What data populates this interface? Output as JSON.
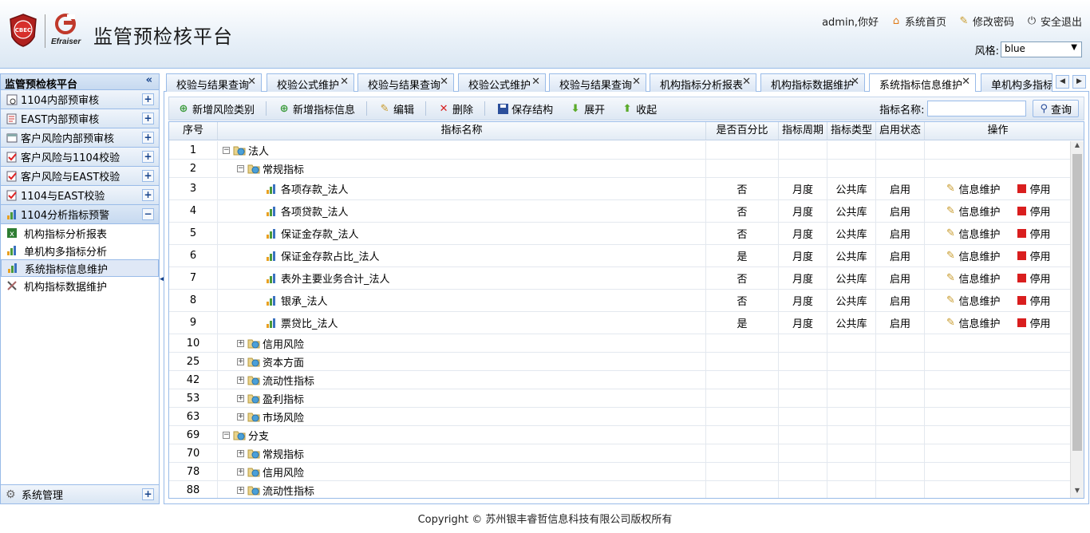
{
  "header": {
    "title": "监管预检核平台",
    "logo_text": "CBEC",
    "logo2_text": "Efraiser",
    "user_greeting": "admin,你好",
    "links": [
      "系统首页",
      "修改密码",
      "安全退出"
    ],
    "style_label": "风格:",
    "style_value": "blue"
  },
  "sidebar": {
    "title": "监管预检核平台",
    "groups": [
      {
        "label": "1104内部预审核",
        "icon": "report-gear-icon",
        "toggle": "+"
      },
      {
        "label": "EAST内部预审核",
        "icon": "report-edit-icon",
        "toggle": "+"
      },
      {
        "label": "客户风险内部预审核",
        "icon": "window-icon",
        "toggle": "+"
      },
      {
        "label": "客户风险与1104校验",
        "icon": "check-doc-icon",
        "toggle": "+"
      },
      {
        "label": "客户风险与EAST校验",
        "icon": "check-doc-icon",
        "toggle": "+"
      },
      {
        "label": "1104与EAST校验",
        "icon": "check-doc-icon",
        "toggle": "+"
      },
      {
        "label": "1104分析指标预警",
        "icon": "bar-chart-icon",
        "toggle": "−"
      }
    ],
    "items": [
      {
        "label": "机构指标分析报表",
        "icon": "excel-icon"
      },
      {
        "label": "单机构多指标分析",
        "icon": "bar-chart-icon"
      },
      {
        "label": "系统指标信息维护",
        "icon": "bar-chart-icon",
        "selected": true
      },
      {
        "label": "机构指标数据维护",
        "icon": "tools-icon"
      }
    ],
    "bottom": {
      "label": "系统管理",
      "toggle": "+"
    }
  },
  "tabs": [
    {
      "label": "校验与结果查询"
    },
    {
      "label": "校验公式维护"
    },
    {
      "label": "校验与结果查询"
    },
    {
      "label": "校验公式维护"
    },
    {
      "label": "校验与结果查询"
    },
    {
      "label": "机构指标分析报表"
    },
    {
      "label": "机构指标数据维护"
    },
    {
      "label": "系统指标信息维护",
      "active": true
    },
    {
      "label": "单机构多指标分析"
    }
  ],
  "toolbar": {
    "add_risk": "新增风险类别",
    "add_index": "新增指标信息",
    "edit": "编辑",
    "delete": "删除",
    "save": "保存结构",
    "expand": "展开",
    "collapse": "收起",
    "search_label": "指标名称:",
    "search_value": "",
    "search_button": "查询"
  },
  "grid": {
    "columns": [
      "序号",
      "指标名称",
      "是否百分比",
      "指标周期",
      "指标类型",
      "启用状态",
      "操作"
    ],
    "op_edit": "信息维护",
    "op_stop": "停用",
    "rows": [
      {
        "no": "1",
        "name": "法人",
        "level": 0,
        "node": "folder",
        "toggle": "−"
      },
      {
        "no": "2",
        "name": "常规指标",
        "level": 1,
        "node": "folder",
        "toggle": "−"
      },
      {
        "no": "3",
        "name": "各项存款_法人",
        "level": 2,
        "node": "leaf",
        "pct": "否",
        "period": "月度",
        "type": "公共库",
        "status": "启用"
      },
      {
        "no": "4",
        "name": "各项贷款_法人",
        "level": 2,
        "node": "leaf",
        "pct": "否",
        "period": "月度",
        "type": "公共库",
        "status": "启用"
      },
      {
        "no": "5",
        "name": "保证金存款_法人",
        "level": 2,
        "node": "leaf",
        "pct": "否",
        "period": "月度",
        "type": "公共库",
        "status": "启用"
      },
      {
        "no": "6",
        "name": "保证金存款占比_法人",
        "level": 2,
        "node": "leaf",
        "pct": "是",
        "period": "月度",
        "type": "公共库",
        "status": "启用"
      },
      {
        "no": "7",
        "name": "表外主要业务合计_法人",
        "level": 2,
        "node": "leaf",
        "pct": "否",
        "period": "月度",
        "type": "公共库",
        "status": "启用"
      },
      {
        "no": "8",
        "name": "银承_法人",
        "level": 2,
        "node": "leaf",
        "pct": "否",
        "period": "月度",
        "type": "公共库",
        "status": "启用"
      },
      {
        "no": "9",
        "name": "票贷比_法人",
        "level": 2,
        "node": "leaf",
        "pct": "是",
        "period": "月度",
        "type": "公共库",
        "status": "启用"
      },
      {
        "no": "10",
        "name": "信用风险",
        "level": 1,
        "node": "folder",
        "toggle": "+"
      },
      {
        "no": "25",
        "name": "资本方面",
        "level": 1,
        "node": "folder",
        "toggle": "+"
      },
      {
        "no": "42",
        "name": "流动性指标",
        "level": 1,
        "node": "folder",
        "toggle": "+"
      },
      {
        "no": "53",
        "name": "盈利指标",
        "level": 1,
        "node": "folder",
        "toggle": "+"
      },
      {
        "no": "63",
        "name": "市场风险",
        "level": 1,
        "node": "folder",
        "toggle": "+"
      },
      {
        "no": "69",
        "name": "分支",
        "level": 0,
        "node": "folder",
        "toggle": "−"
      },
      {
        "no": "70",
        "name": "常规指标",
        "level": 1,
        "node": "folder",
        "toggle": "+"
      },
      {
        "no": "78",
        "name": "信用风险",
        "level": 1,
        "node": "folder",
        "toggle": "+"
      },
      {
        "no": "88",
        "name": "流动性指标",
        "level": 1,
        "node": "folder",
        "toggle": "+"
      }
    ]
  },
  "footer": "Copyright © 苏州银丰睿哲信息科技有限公司版权所有"
}
